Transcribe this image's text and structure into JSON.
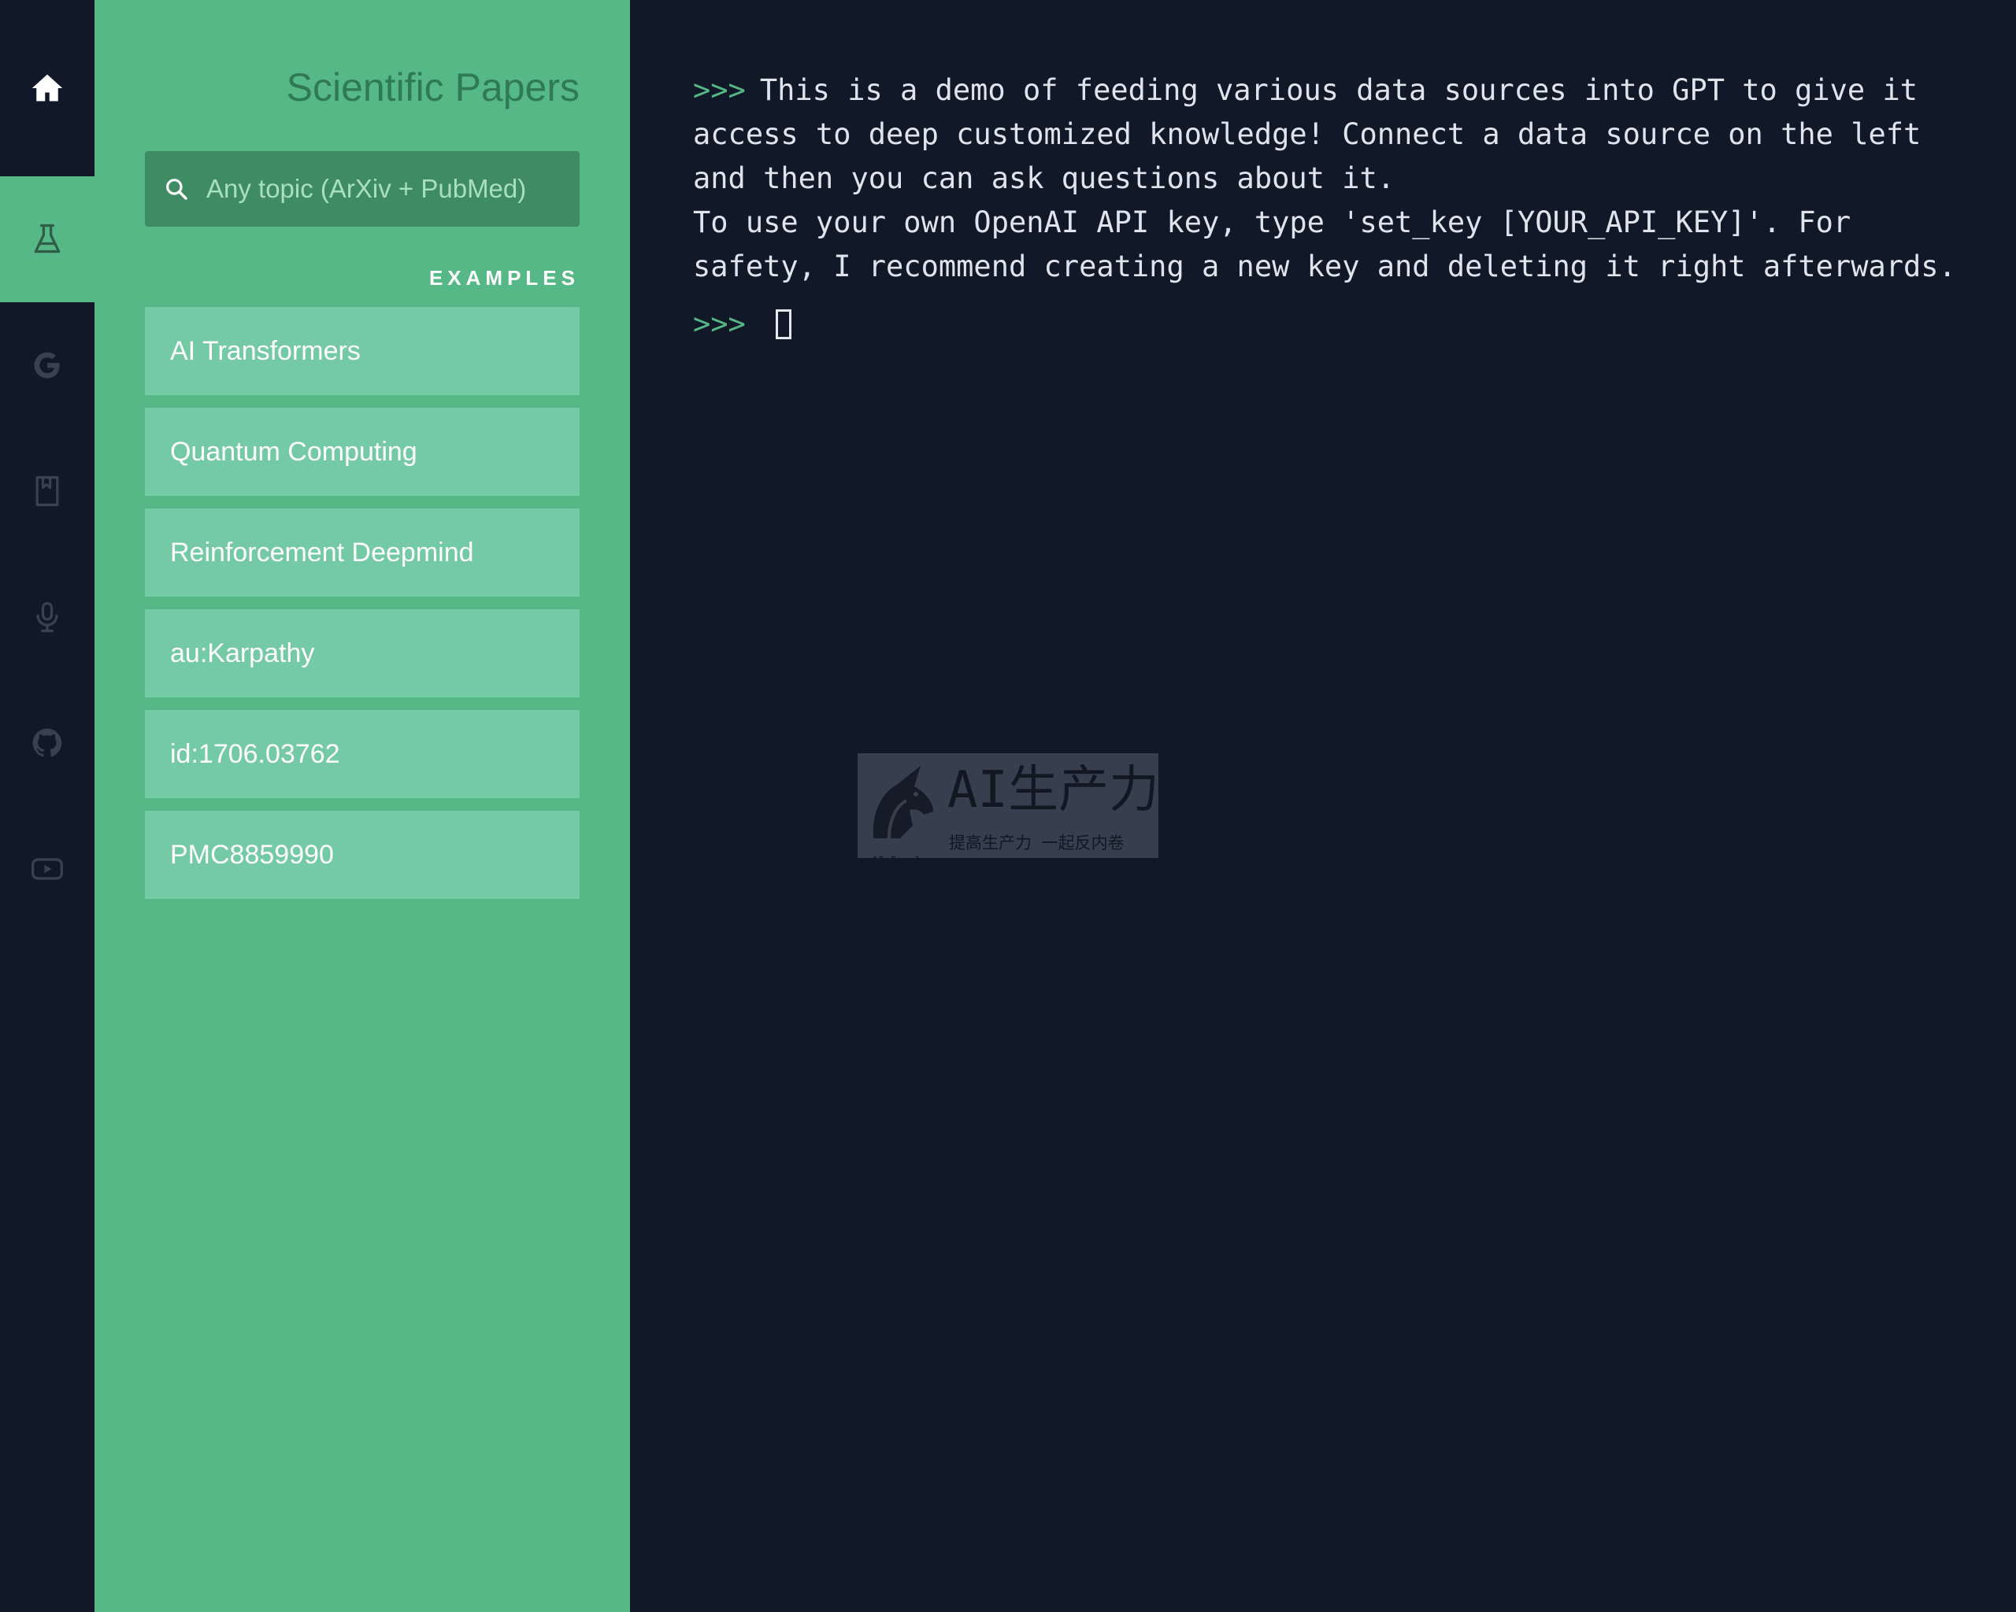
{
  "rail": {
    "items": [
      {
        "icon": "home-icon",
        "active": false
      },
      {
        "icon": "flask-icon",
        "active": true
      },
      {
        "icon": "google-icon",
        "active": false
      },
      {
        "icon": "book-icon",
        "active": false
      },
      {
        "icon": "microphone-icon",
        "active": false
      },
      {
        "icon": "github-icon",
        "active": false
      },
      {
        "icon": "youtube-icon",
        "active": false
      }
    ]
  },
  "panel": {
    "title": "Scientific Papers",
    "search": {
      "placeholder": "Any topic (ArXiv + PubMed)",
      "value": ""
    },
    "examples_label": "EXAMPLES",
    "examples": [
      "AI Transformers",
      "Quantum Computing",
      "Reinforcement Deepmind",
      "au:Karpathy",
      "id:1706.03762",
      "PMC8859990"
    ]
  },
  "terminal": {
    "prompt": ">>>",
    "lines": [
      "This is a demo of feeding various data sources into GPT to give it",
      "access to deep customized knowledge! Connect a data source on the left",
      "and then you can ask questions about it.",
      "To use your own OpenAI API key, type 'set_key [YOUR_API_KEY]'. For",
      "safety, I recommend creating a new key and deleting it right afterwards."
    ],
    "input_value": ""
  },
  "watermark": {
    "main": "AI生产力",
    "sub": "提高生产力 一起反内卷",
    "tiny": "AI Impulse"
  },
  "colors": {
    "rail_bg": "#111827",
    "panel_green": "#56b886",
    "example_green": "#74caa4",
    "search_bg": "#3f8c64",
    "terminal_bg": "#111827",
    "prompt_green": "#56b886"
  }
}
